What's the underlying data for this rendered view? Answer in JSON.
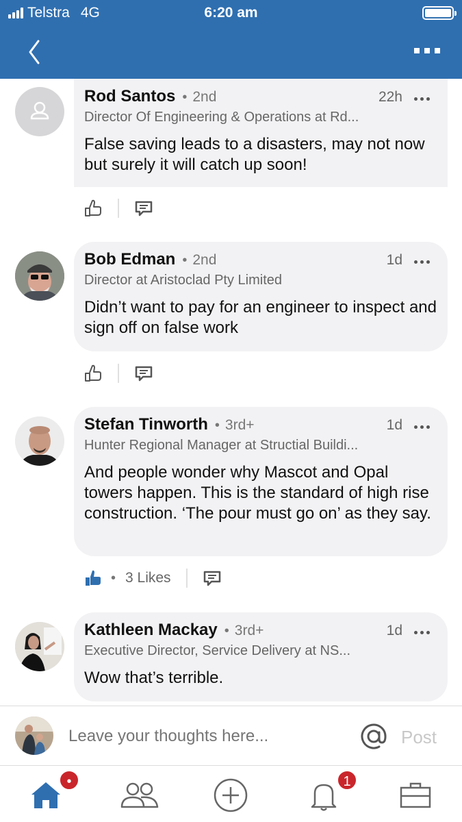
{
  "status": {
    "carrier": "Telstra",
    "network": "4G",
    "time": "6:20 am"
  },
  "comments": [
    {
      "name": "Rod Santos",
      "degree": "2nd",
      "time": "22h",
      "headline": "Director Of Engineering & Operations at Rd...",
      "text": "False saving leads to a disasters, may not now but surely it will catch up soon!",
      "avatar": "default-person-icon"
    },
    {
      "name": "Bob Edman",
      "degree": "2nd",
      "time": "1d",
      "headline": "Director at Aristoclad Pty Limited",
      "text": "Didn’t want to pay for an engineer to inspect and sign off on false work"
    },
    {
      "name": "Stefan Tinworth",
      "degree": "3rd+",
      "time": "1d",
      "headline": "Hunter Regional Manager at Structial Buildi...",
      "text": "And people wonder why Mascot and Opal towers happen. This is the standard of high rise construction. ‘The pour must go on’ as they say.",
      "likes": "3 Likes"
    },
    {
      "name": "Kathleen Mackay",
      "degree": "3rd+",
      "time": "1d",
      "headline": "Executive Director, Service Delivery at NS...",
      "text": "Wow that’s terrible."
    }
  ],
  "composer": {
    "placeholder": "Leave your thoughts here...",
    "post_label": "Post"
  },
  "tabbar": {
    "notifications_badge": "1"
  },
  "colors": {
    "brand": "#2f6fb0",
    "badge": "#c9262c",
    "bubble": "#f2f2f4",
    "liked": "#2f6fb0"
  }
}
